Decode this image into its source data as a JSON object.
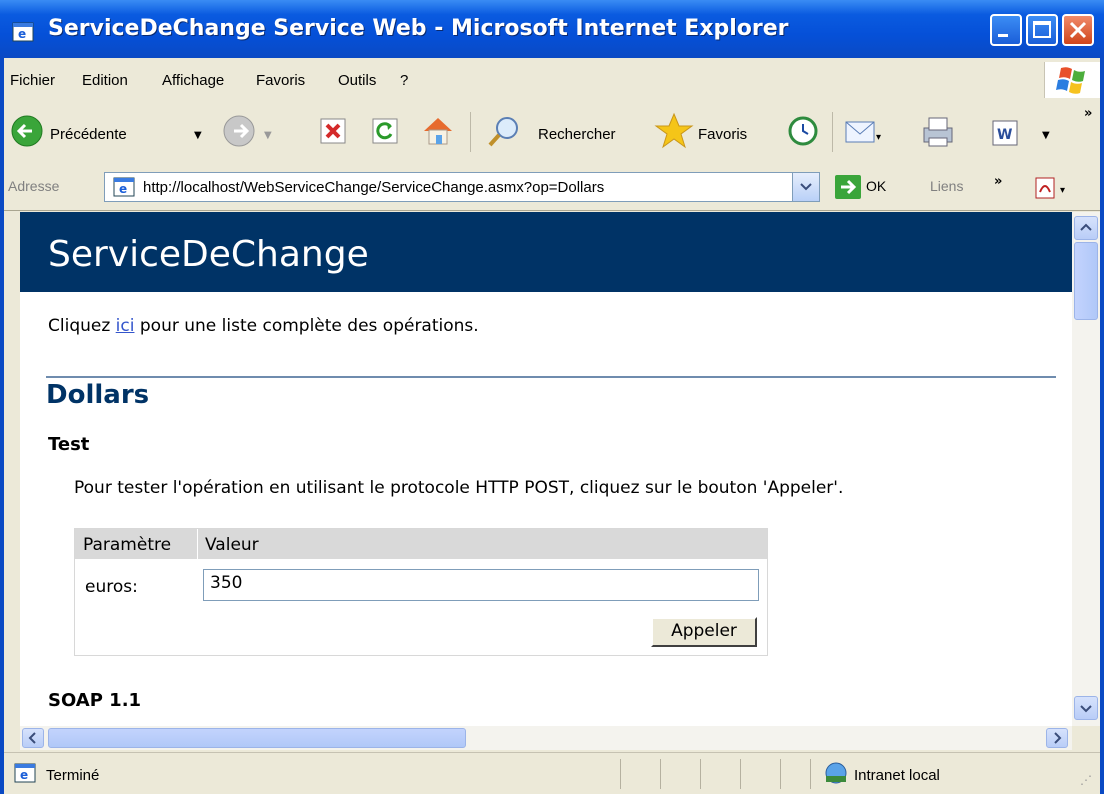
{
  "window": {
    "title": "ServiceDeChange Service Web - Microsoft Internet Explorer"
  },
  "menu": {
    "items": [
      {
        "label": "Fichier"
      },
      {
        "label": "Edition"
      },
      {
        "label": "Affichage"
      },
      {
        "label": "Favoris"
      },
      {
        "label": "Outils"
      },
      {
        "label": "?"
      }
    ]
  },
  "toolbar": {
    "back_label": "Précédente",
    "search_label": "Rechercher",
    "favorites_label": "Favoris"
  },
  "address": {
    "label": "Adresse",
    "url": "http://localhost/WebServiceChange/ServiceChange.asmx?op=Dollars",
    "go_label": "OK",
    "links_label": "Liens"
  },
  "page": {
    "service_title": "ServiceDeChange",
    "intro_before": "Cliquez ",
    "intro_link": "ici",
    "intro_after": " pour une liste complète des opérations.",
    "operation_title": "Dollars",
    "test_heading": "Test",
    "test_description": "Pour tester l'opération en utilisant le protocole HTTP POST, cliquez sur le bouton 'Appeler'.",
    "table_header_param": "Paramètre",
    "table_header_value": "Valeur",
    "param_name": "euros:",
    "param_value": "350",
    "call_button": "Appeler",
    "soap_heading": "SOAP 1.1"
  },
  "status": {
    "text": "Terminé",
    "zone": "Intranet local"
  },
  "colors": {
    "header_bg": "#003366",
    "link": "#3355cc",
    "titlebar": "#0a5be0"
  }
}
